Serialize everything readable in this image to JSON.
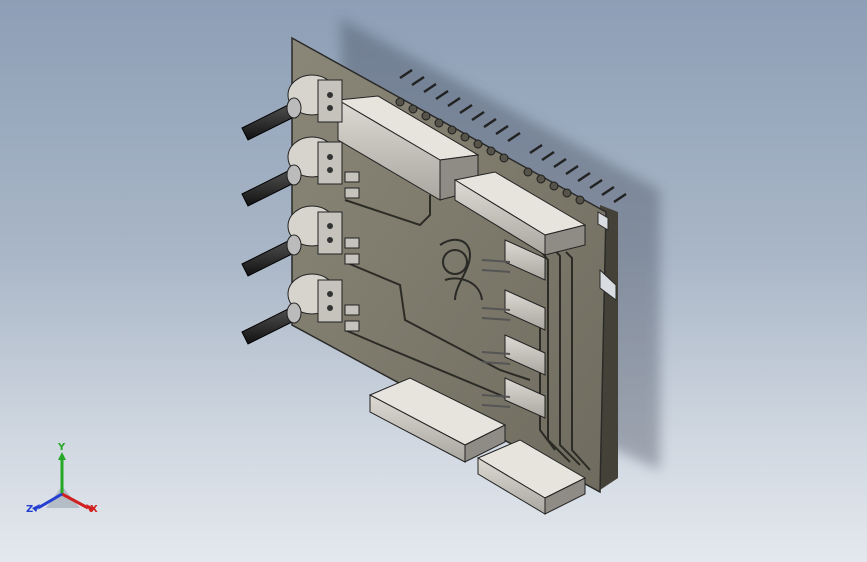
{
  "app": {
    "view": "isometric-3d-model-view"
  },
  "model": {
    "part": "pcb-shield-board",
    "components": {
      "potentiometers": 4,
      "pin_headers": 4,
      "right_angle_connectors": 4
    },
    "colors": {
      "board": "#7d7a6c",
      "board_dark": "#5f5d52",
      "edge": "#2a2a28",
      "component": "#c9c7bf",
      "knob": "#1c1c1c"
    }
  },
  "triad": {
    "x_label": "X",
    "y_label": "Y",
    "z_label": "Z",
    "colors": {
      "x": "#d12020",
      "y": "#25a825",
      "z": "#2540d0"
    }
  }
}
